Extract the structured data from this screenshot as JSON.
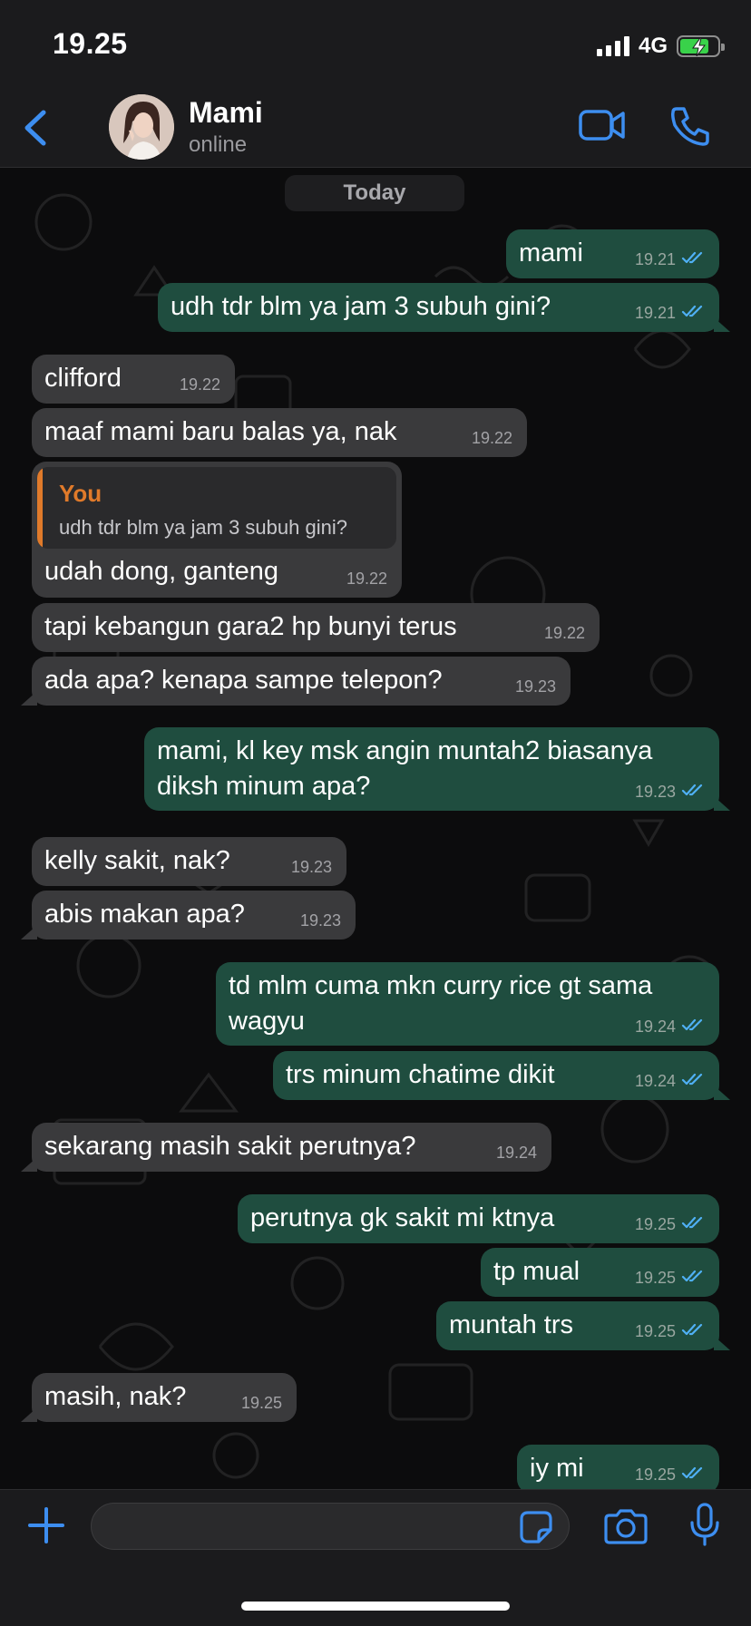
{
  "status_bar": {
    "time": "19.25",
    "network": "4G"
  },
  "header": {
    "contact_name": "Mami",
    "contact_status": "online"
  },
  "date_separator": "Today",
  "messages": [
    {
      "dir": "out",
      "text": "mami",
      "time": "19.21",
      "read": true
    },
    {
      "dir": "out",
      "text": "udh tdr blm ya jam 3 subuh gini?",
      "time": "19.21",
      "read": true
    },
    {
      "dir": "in",
      "text": "clifford",
      "time": "19.22"
    },
    {
      "dir": "in",
      "text": "maaf mami baru balas ya, nak",
      "time": "19.22"
    },
    {
      "dir": "in",
      "text": "udah dong, ganteng",
      "time": "19.22",
      "quote": {
        "author": "You",
        "text": "udh tdr blm ya jam 3 subuh gini?"
      }
    },
    {
      "dir": "in",
      "text": "tapi kebangun gara2 hp bunyi terus",
      "time": "19.22"
    },
    {
      "dir": "in",
      "text": "ada apa? kenapa sampe telepon?",
      "time": "19.23"
    },
    {
      "dir": "out",
      "text_line1": "mami, kl key msk angin muntah2 biasanya",
      "text_line2": "diksh minum apa?",
      "time": "19.23",
      "read": true
    },
    {
      "dir": "in",
      "text": "kelly sakit, nak?",
      "time": "19.23"
    },
    {
      "dir": "in",
      "text": "abis makan apa?",
      "time": "19.23"
    },
    {
      "dir": "out",
      "text_line1": "td mlm cuma mkn curry rice gt sama",
      "text_line2": "wagyu",
      "time": "19.24",
      "read": true
    },
    {
      "dir": "out",
      "text": "trs minum chatime dikit",
      "time": "19.24",
      "read": true
    },
    {
      "dir": "in",
      "text": "sekarang masih sakit perutnya?",
      "time": "19.24"
    },
    {
      "dir": "out",
      "text": "perutnya gk sakit mi ktnya",
      "time": "19.25",
      "read": true
    },
    {
      "dir": "out",
      "text": "tp mual",
      "time": "19.25",
      "read": true
    },
    {
      "dir": "out",
      "text": "muntah trs",
      "time": "19.25",
      "read": true
    },
    {
      "dir": "in",
      "text": "masih, nak?",
      "time": "19.25"
    },
    {
      "dir": "out",
      "text": "iy mi",
      "time": "19.25",
      "read": true
    }
  ],
  "icons": {
    "back": "chevron-left-icon",
    "video": "video-camera-icon",
    "call": "phone-icon",
    "plus": "plus-icon",
    "sticker": "sticker-icon",
    "camera": "camera-icon",
    "mic": "microphone-icon"
  },
  "colors": {
    "accent": "#3d8ef0",
    "outgoing_bubble": "#1f4d3f",
    "incoming_bubble": "#3a3a3c",
    "quote_author": "#e07a2a",
    "read_ticks": "#4fb0f5"
  }
}
